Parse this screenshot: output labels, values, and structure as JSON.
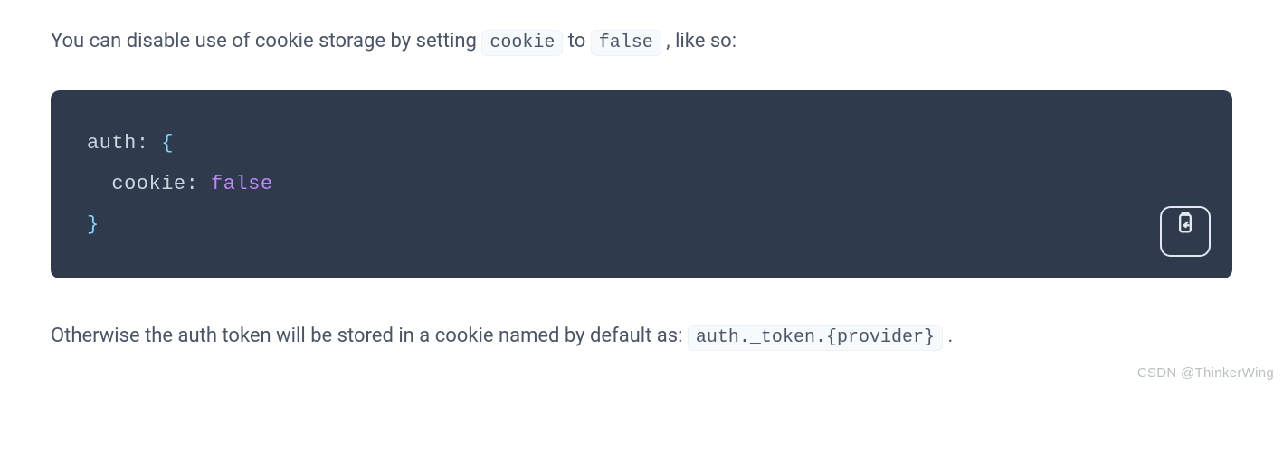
{
  "para1": {
    "before": "You can disable use of cookie storage by setting ",
    "code1": "cookie",
    "mid": " to ",
    "code2": "false",
    "after": ", like so:"
  },
  "code": {
    "l1_key": "auth",
    "l1_colon": ":",
    "l1_brace": " {",
    "l2_indent": "  ",
    "l2_key": "cookie",
    "l2_colon": ":",
    "l2_val": " false",
    "l3_brace": "}"
  },
  "para2": {
    "before": "Otherwise the auth token will be stored in a cookie named by default as: ",
    "code1": "auth._token.{provider}",
    "after": "."
  },
  "watermark": "CSDN @ThinkerWing"
}
